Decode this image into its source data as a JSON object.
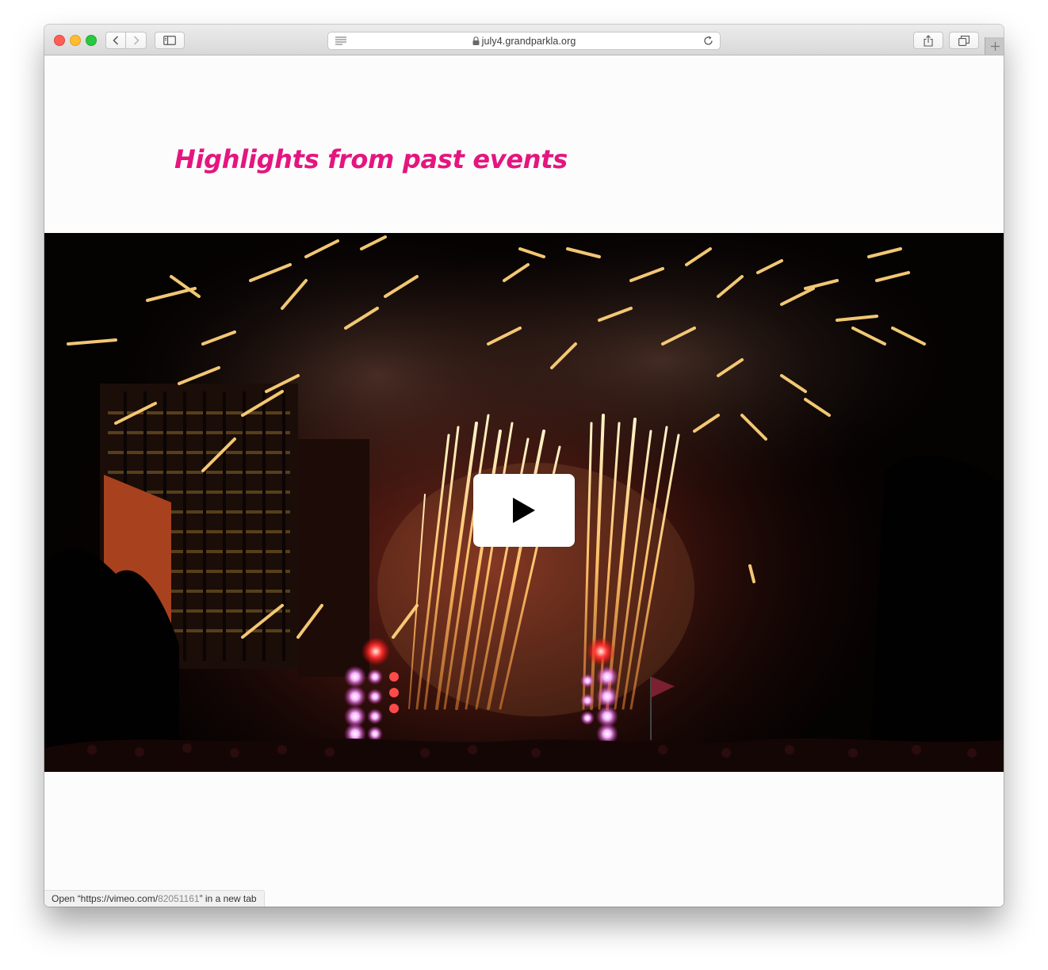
{
  "browser": {
    "url": "july4.grandparkla.org"
  },
  "page": {
    "heading": "Highlights from past events",
    "heading_color": "#e5157f",
    "background": "#fbfcfb"
  },
  "video": {
    "provider": "vimeo",
    "play_icon": "play-icon"
  },
  "status_bar": {
    "prefix": "Open “https://vimeo.com/",
    "id": "82051161",
    "suffix": "” in a new tab"
  }
}
